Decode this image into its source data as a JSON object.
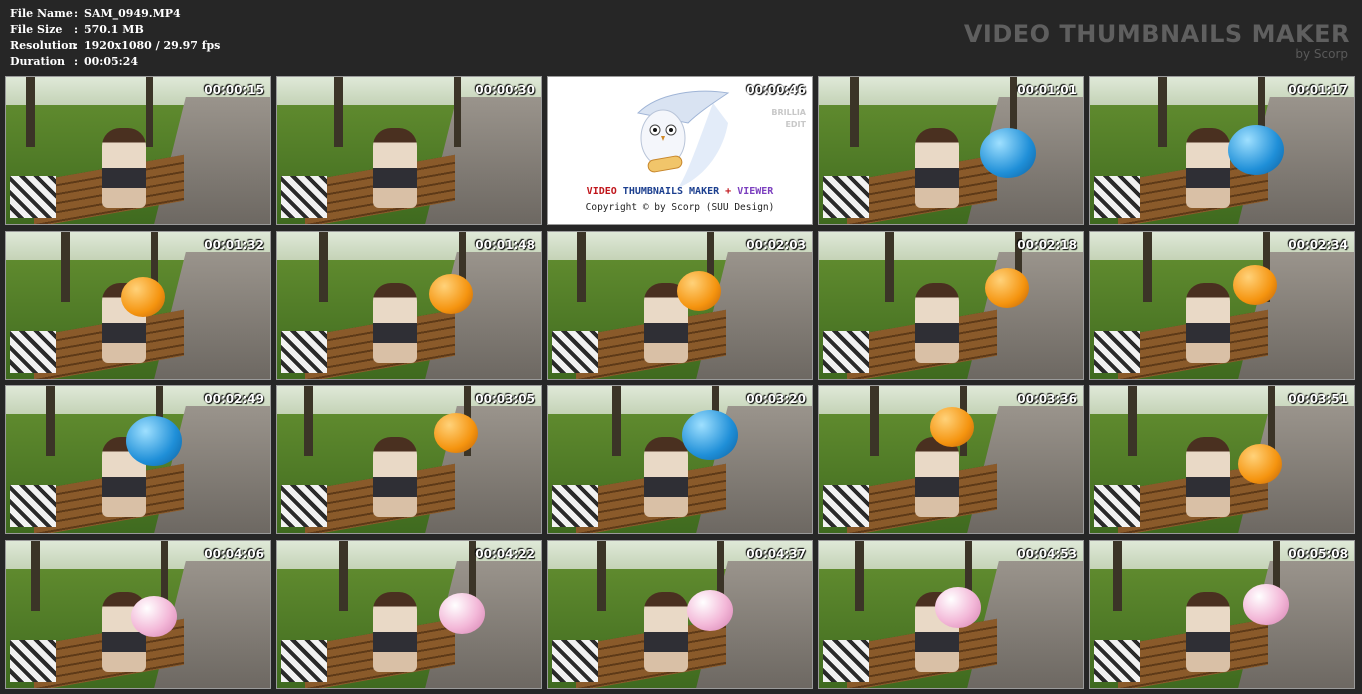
{
  "info": {
    "rows": [
      {
        "key": "File Name",
        "sep": ":",
        "value": "SAM_0949.MP4"
      },
      {
        "key": "File Size",
        "sep": ":",
        "value": "570.1 MB"
      },
      {
        "key": "Resolution",
        "sep": ":",
        "value": "1920x1080 / 29.97 fps"
      },
      {
        "key": "Duration",
        "sep": ":",
        "value": "00:05:24"
      }
    ]
  },
  "brand": {
    "title": "VIDEO THUMBNAILS MAKER",
    "subtitle": "by Scorp"
  },
  "logo": {
    "title_a": "VIDEO ",
    "title_b": "THUMBNAILS MAKER",
    "title_c": " + ",
    "title_d": "VIEWER",
    "copyright": "Copyright © by Scorp (SUU Design)",
    "side_1": "BRILLIA",
    "side_2": "EDIT"
  },
  "colors": {
    "blue": "#1f8fd8",
    "orange": "#f5940f",
    "pink": "#f3b8d8",
    "logo_red": "#c0151b",
    "logo_blue": "#1c3f8f",
    "logo_purple": "#7b3fbf"
  },
  "thumbnails": [
    {
      "time": "00:00:15",
      "balloon": "none"
    },
    {
      "time": "00:00:30",
      "balloon": "none"
    },
    {
      "time": "00:00:46",
      "balloon": "logo"
    },
    {
      "time": "00:01:01",
      "balloon": "blue"
    },
    {
      "time": "00:01:17",
      "balloon": "blue"
    },
    {
      "time": "00:01:32",
      "balloon": "orange"
    },
    {
      "time": "00:01:48",
      "balloon": "orange"
    },
    {
      "time": "00:02:03",
      "balloon": "orange"
    },
    {
      "time": "00:02:18",
      "balloon": "orange"
    },
    {
      "time": "00:02:34",
      "balloon": "orange"
    },
    {
      "time": "00:02:49",
      "balloon": "blue"
    },
    {
      "time": "00:03:05",
      "balloon": "orange"
    },
    {
      "time": "00:03:20",
      "balloon": "blue"
    },
    {
      "time": "00:03:36",
      "balloon": "orange"
    },
    {
      "time": "00:03:51",
      "balloon": "orange"
    },
    {
      "time": "00:04:06",
      "balloon": "pink"
    },
    {
      "time": "00:04:22",
      "balloon": "pink"
    },
    {
      "time": "00:04:37",
      "balloon": "pink"
    },
    {
      "time": "00:04:53",
      "balloon": "pink"
    },
    {
      "time": "00:05:08",
      "balloon": "pink"
    }
  ]
}
